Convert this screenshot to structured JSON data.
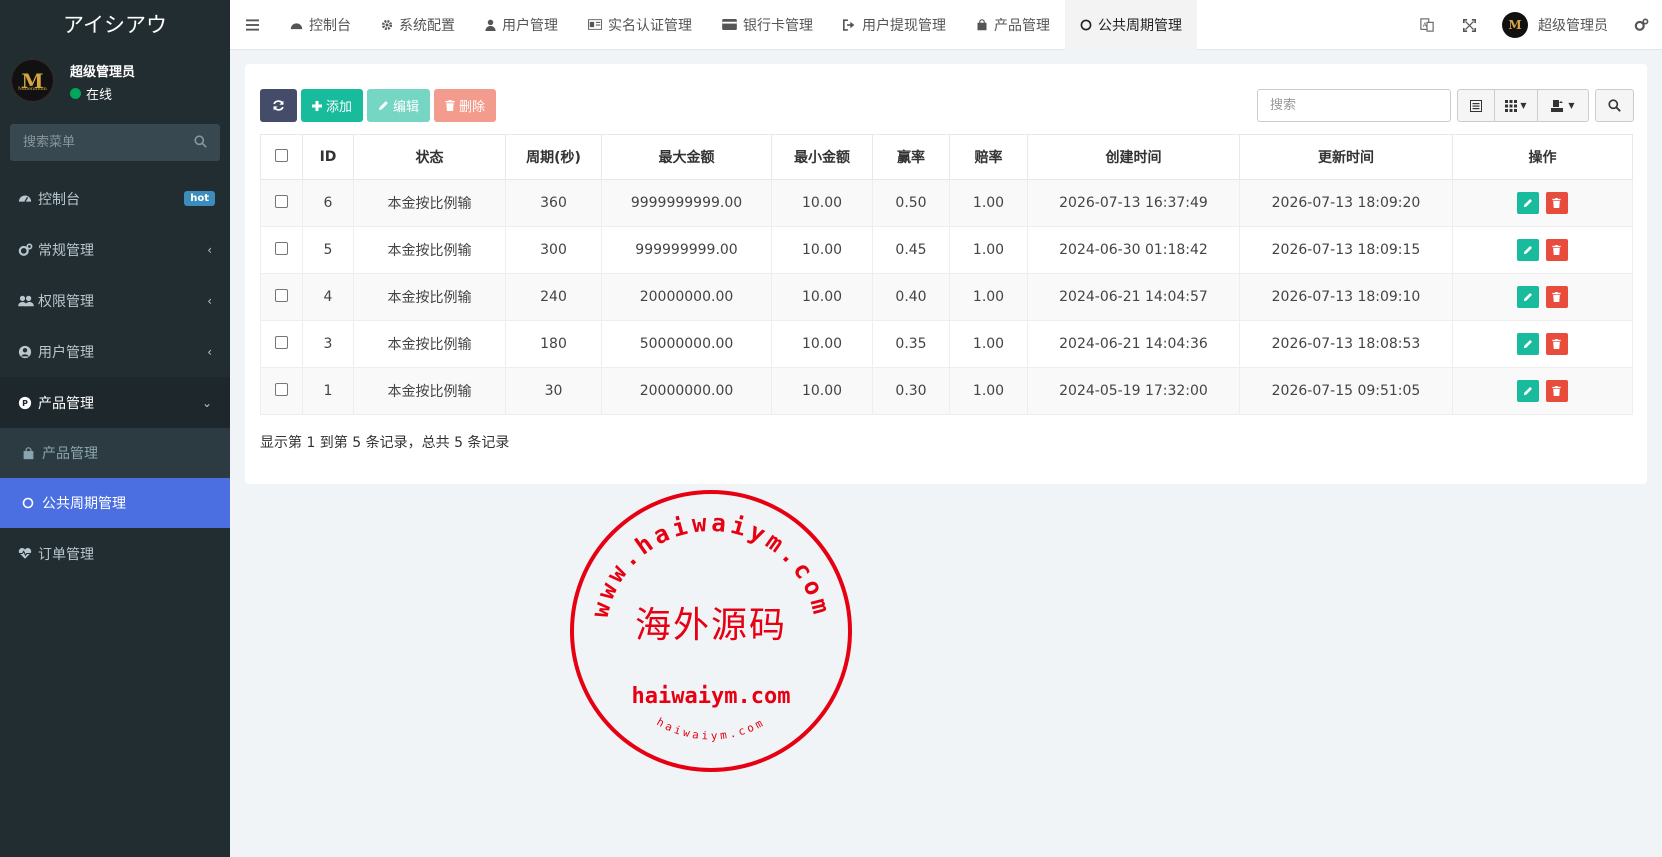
{
  "brand": "アイシアウ",
  "user": {
    "avatar_letter": "M",
    "avatar_sub": "Millennium",
    "name": "超级管理员",
    "status": "在线"
  },
  "sidebar": {
    "search_placeholder": "搜索菜单",
    "items": [
      {
        "label": "控制台",
        "icon": "dashboard-icon",
        "badge": "hot"
      },
      {
        "label": "常规管理",
        "icon": "cogs-icon"
      },
      {
        "label": "权限管理",
        "icon": "group-icon"
      },
      {
        "label": "用户管理",
        "icon": "user-circle-icon"
      },
      {
        "label": "产品管理",
        "icon": "product-hunt-icon"
      }
    ],
    "sub_items": [
      {
        "label": "产品管理",
        "icon": "shopping-bag-icon"
      },
      {
        "label": "公共周期管理",
        "icon": "circle-icon"
      }
    ],
    "last_item": {
      "label": "订单管理",
      "icon": "heartbeat-icon"
    }
  },
  "topnav": {
    "tabs": [
      {
        "label": "控制台",
        "icon": "dashboard-icon"
      },
      {
        "label": "系统配置",
        "icon": "cog-icon"
      },
      {
        "label": "用户管理",
        "icon": "user-icon"
      },
      {
        "label": "实名认证管理",
        "icon": "id-card-icon"
      },
      {
        "label": "银行卡管理",
        "icon": "credit-card-icon"
      },
      {
        "label": "用户提现管理",
        "icon": "sign-out-icon"
      },
      {
        "label": "产品管理",
        "icon": "shopping-bag-icon"
      },
      {
        "label": "公共周期管理",
        "icon": "circle-icon"
      }
    ],
    "admin_name": "超级管理员"
  },
  "toolbar": {
    "add": "添加",
    "edit": "编辑",
    "delete": "删除",
    "search_placeholder": "搜索"
  },
  "table": {
    "headers": [
      "ID",
      "状态",
      "周期(秒)",
      "最大金额",
      "最小金额",
      "赢率",
      "赔率",
      "创建时间",
      "更新时间",
      "操作"
    ],
    "rows": [
      [
        "6",
        "本金按比例输",
        "360",
        "9999999999.00",
        "10.00",
        "0.50",
        "1.00",
        "2026-07-13 16:37:49",
        "2026-07-13 18:09:20"
      ],
      [
        "5",
        "本金按比例输",
        "300",
        "999999999.00",
        "10.00",
        "0.45",
        "1.00",
        "2024-06-30 01:18:42",
        "2026-07-13 18:09:15"
      ],
      [
        "4",
        "本金按比例输",
        "240",
        "20000000.00",
        "10.00",
        "0.40",
        "1.00",
        "2024-06-21 14:04:57",
        "2026-07-13 18:09:10"
      ],
      [
        "3",
        "本金按比例输",
        "180",
        "50000000.00",
        "10.00",
        "0.35",
        "1.00",
        "2024-06-21 14:04:36",
        "2026-07-13 18:08:53"
      ],
      [
        "1",
        "本金按比例输",
        "30",
        "20000000.00",
        "10.00",
        "0.30",
        "1.00",
        "2024-05-19 17:32:00",
        "2026-07-15 09:51:05"
      ]
    ]
  },
  "pagination_info": "显示第 1 到第 5 条记录，总共 5 条记录",
  "watermark": {
    "outer_text": "www.haiwaiym.com",
    "center_text": "海外源码",
    "domain_text": "haiwaiym.com",
    "bottom_text": "haiwaiym.com",
    "color": "#e60012"
  }
}
